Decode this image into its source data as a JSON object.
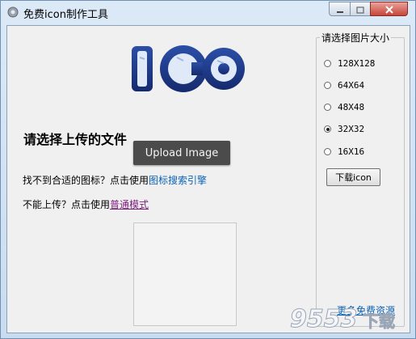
{
  "window": {
    "title": "免费icon制作工具"
  },
  "logo": {
    "text": "ICO"
  },
  "main": {
    "heading": "请选择上传的文件",
    "upload_label": "Upload Image",
    "search_prefix": "找不到合适的图标？点击使用",
    "search_link": "图标搜索引擎",
    "normal_prefix": "不能上传？点击使用",
    "normal_link": "普通模式"
  },
  "size_panel": {
    "title": "请选择图片大小",
    "options": [
      {
        "label": "128X128",
        "selected": false
      },
      {
        "label": "64X64",
        "selected": false
      },
      {
        "label": "48X48",
        "selected": false
      },
      {
        "label": "32X32",
        "selected": true
      },
      {
        "label": "16X16",
        "selected": false
      }
    ],
    "download_label": "下载icon",
    "more_link": "更多免费资源"
  },
  "watermark": {
    "text": "9553下载"
  },
  "colors": {
    "link": "#0b63b6",
    "visited_link": "#7b1d7b",
    "upload_button": "#4b4b4b",
    "logo_blue": "#233f93"
  }
}
